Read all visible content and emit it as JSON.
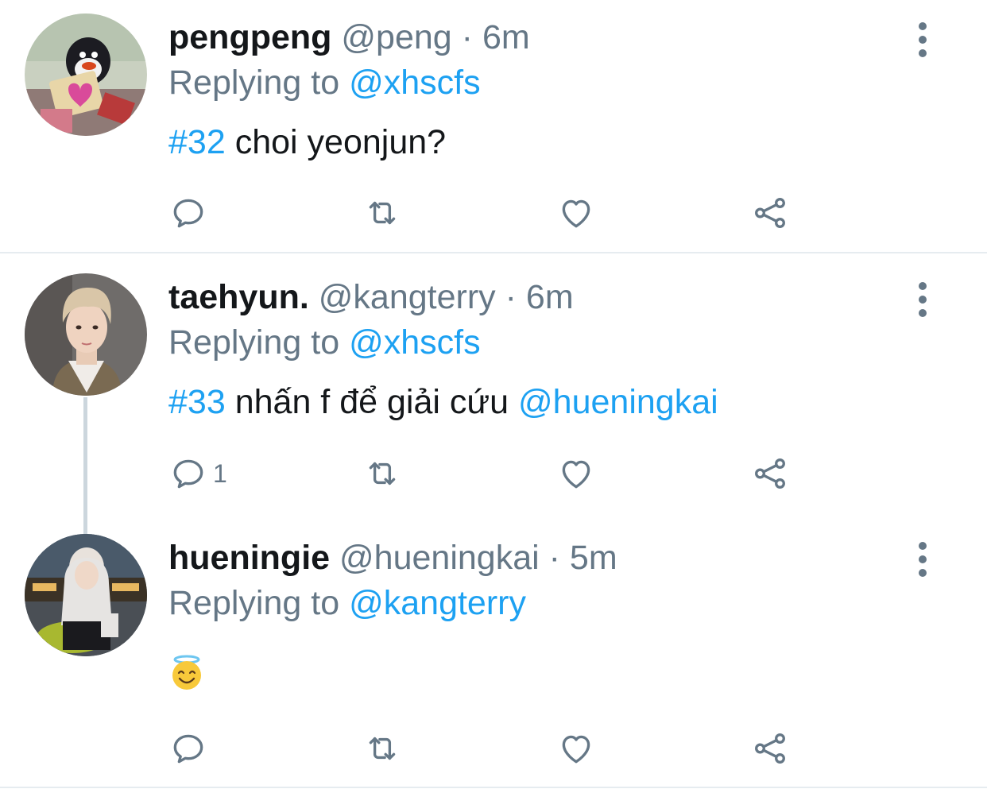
{
  "tweets": [
    {
      "name": "pengpeng",
      "handle": "@peng",
      "dot": "·",
      "time": "6m",
      "replying_prefix": "Replying to",
      "replying_to": "@xhscfs",
      "hashtag": "#32",
      "text": " choi yeonjun?",
      "mention_tail": "",
      "reply_count": ""
    },
    {
      "name": "taehyun.",
      "handle": "@kangterry",
      "dot": "·",
      "time": "6m",
      "replying_prefix": "Replying to",
      "replying_to": "@xhscfs",
      "hashtag": "#33",
      "text": " nhấn f để giải cứu ",
      "mention_tail": "@hueningkai",
      "reply_count": "1"
    },
    {
      "name": "hueningie",
      "handle": "@hueningkai",
      "dot": "·",
      "time": "5m",
      "replying_prefix": "Replying to",
      "replying_to": "@kangterry",
      "emoji": "smiling-face-with-halo",
      "reply_count": ""
    }
  ],
  "icons": {
    "reply": "reply-icon",
    "retweet": "retweet-icon",
    "like": "heart-icon",
    "share": "share-icon",
    "more": "more-vertical-icon"
  },
  "colors": {
    "link": "#1da1f2",
    "secondary": "#657786",
    "text": "#14171a",
    "divider": "#e6ecf0",
    "thread": "#ccd6dd"
  }
}
